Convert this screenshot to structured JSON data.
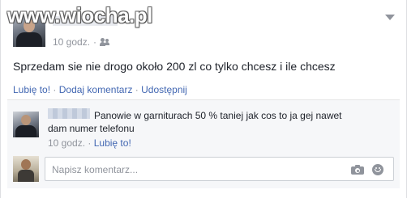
{
  "watermark": "www.wiocha.pl",
  "post": {
    "time": "10 godz.",
    "audience_icon": "friends-icon",
    "text": "Sprzedam sie nie drogo około 200 zl co tylko chcesz i ile chcesz",
    "actions": {
      "like": "Lubię to!",
      "comment": "Dodaj komentarz",
      "share": "Udostępnij",
      "separator": "·"
    }
  },
  "comments": [
    {
      "text": "Panowie w garniturach 50 % taniej jak cos to ja gej nawet dam numer telefonu",
      "time": "10 godz.",
      "like": "Lubię to!",
      "separator": "·"
    }
  ],
  "composer": {
    "placeholder": "Napisz komentarz...",
    "icons": [
      "camera-icon",
      "emoji-icon"
    ]
  },
  "colors": {
    "link": "#4267b2",
    "meta": "#90949c",
    "text": "#1d2129"
  }
}
